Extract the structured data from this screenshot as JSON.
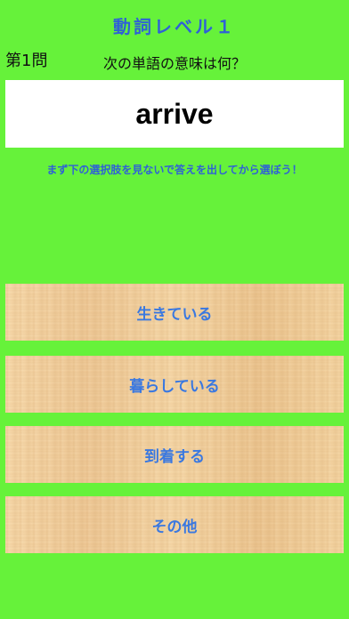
{
  "header": {
    "title": "動詞レベル１",
    "question_number": "第1問",
    "prompt": "次の単語の意味は何？"
  },
  "question": {
    "word": "arrive"
  },
  "hint": "まず下の選択肢を見ないで答えを出してから選ぼう！",
  "choices": [
    {
      "label": "生きている"
    },
    {
      "label": "暮らしている"
    },
    {
      "label": "到着する"
    },
    {
      "label": "その他"
    }
  ],
  "colors": {
    "background": "#66f23a",
    "title_blue": "#2f61d6",
    "choice_text": "#3a78e0",
    "wood": "#f2cf9c"
  }
}
